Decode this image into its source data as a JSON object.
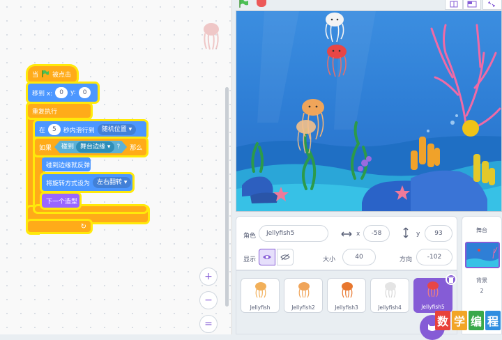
{
  "code": {
    "hat": {
      "prefix": "当",
      "suffix": "被点击"
    },
    "goto": {
      "label": "移到 x:",
      "x": "0",
      "ylabel": "y:",
      "y": "0"
    },
    "forever": {
      "label": "重复执行"
    },
    "glide": {
      "prefix": "在",
      "secs": "5",
      "middle": "秒内滑行到",
      "target": "随机位置 ▾"
    },
    "if": {
      "label": "如果",
      "then": "那么"
    },
    "touching": {
      "label": "碰到",
      "target": "舞台边缘 ▾",
      "q": "?"
    },
    "bounce": {
      "label": "碰到边缘就反弹"
    },
    "rotation": {
      "label": "将旋转方式设为",
      "value": "左右翻转 ▾"
    },
    "next_costume": {
      "label": "下一个造型"
    },
    "zoom": {
      "in": "+",
      "out": "−",
      "reset": "="
    }
  },
  "sprite_info": {
    "sprite_label": "角色",
    "sprite_name": "Jellyfish5",
    "x_label": "x",
    "x_value": "-58",
    "y_label": "y",
    "y_value": "93",
    "show_label": "显示",
    "size_label": "大小",
    "size_value": "40",
    "direction_label": "方向",
    "direction_value": "-102"
  },
  "sprites": [
    {
      "name": "Jellyfish",
      "color": "#f2b05a"
    },
    {
      "name": "Jellyfish2",
      "color": "#f0a55a"
    },
    {
      "name": "Jellyfish3",
      "color": "#e8772e"
    },
    {
      "name": "Jellyfish4",
      "color": "#f4f4f4"
    },
    {
      "name": "Jellyfish5",
      "color": "#e84646"
    }
  ],
  "stage_panel": {
    "title": "舞台",
    "backdrop_label": "背景",
    "backdrop_count": "2"
  },
  "watermark": [
    "数",
    "学",
    "编",
    "程"
  ],
  "colors": {
    "events": "#ffab19",
    "motion": "#4c97ff",
    "sensing": "#5cb1d6",
    "looks": "#9966ff",
    "highlight": "#ffe90a",
    "selected": "#855cd6"
  }
}
